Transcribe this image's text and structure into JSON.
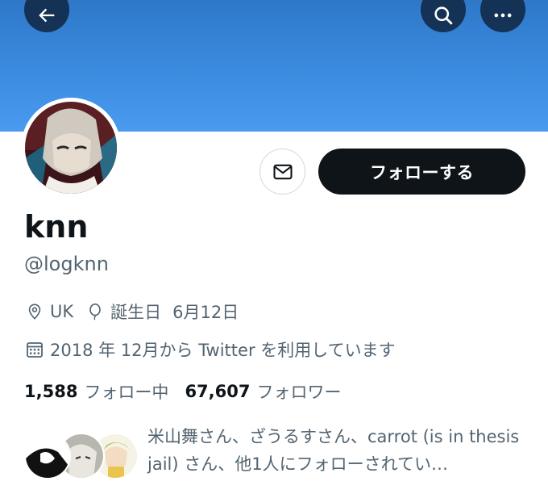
{
  "profile": {
    "display_name": "knn",
    "handle": "@logknn",
    "location": "UK",
    "birthday_label": "誕生日",
    "birthday_value": "6月12日",
    "joined": "2018 年 12月から Twitter を利用しています"
  },
  "actions": {
    "follow_label": "フォローする"
  },
  "stats": {
    "following_count": "1,588",
    "following_label": "フォロー中",
    "followers_count": "67,607",
    "followers_label": "フォロワー"
  },
  "known_followers": {
    "text": "米山舞さん、ざうるすさん、carrot (is in thesis jail) さん、他1人にフォローされてい…"
  },
  "icons": [
    "back-arrow-icon",
    "search-icon",
    "more-icon",
    "mail-icon",
    "location-pin-icon",
    "balloon-icon",
    "calendar-icon"
  ],
  "colors": {
    "banner": "#3b8be0",
    "follow_button": "#0f1419",
    "secondary_text": "#536471"
  }
}
